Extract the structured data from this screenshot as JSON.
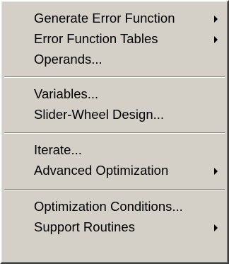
{
  "menu": {
    "groups": [
      {
        "items": [
          {
            "label": "Generate Error Function",
            "submenu": true
          },
          {
            "label": "Error Function Tables",
            "submenu": true
          },
          {
            "label": "Operands...",
            "submenu": false
          }
        ]
      },
      {
        "items": [
          {
            "label": "Variables...",
            "submenu": false
          },
          {
            "label": "Slider-Wheel Design...",
            "submenu": false
          }
        ]
      },
      {
        "items": [
          {
            "label": "Iterate...",
            "submenu": false
          },
          {
            "label": "Advanced Optimization",
            "submenu": true
          }
        ]
      },
      {
        "items": [
          {
            "label": "Optimization Conditions...",
            "submenu": false
          },
          {
            "label": "Support Routines",
            "submenu": true
          }
        ]
      }
    ]
  },
  "icons": {
    "submenu_arrow": "chevron-right-icon"
  },
  "colors": {
    "menu_background": "#d4d0c8",
    "separator_dark": "#808080",
    "separator_light": "#ffffff",
    "text": "#000000"
  }
}
